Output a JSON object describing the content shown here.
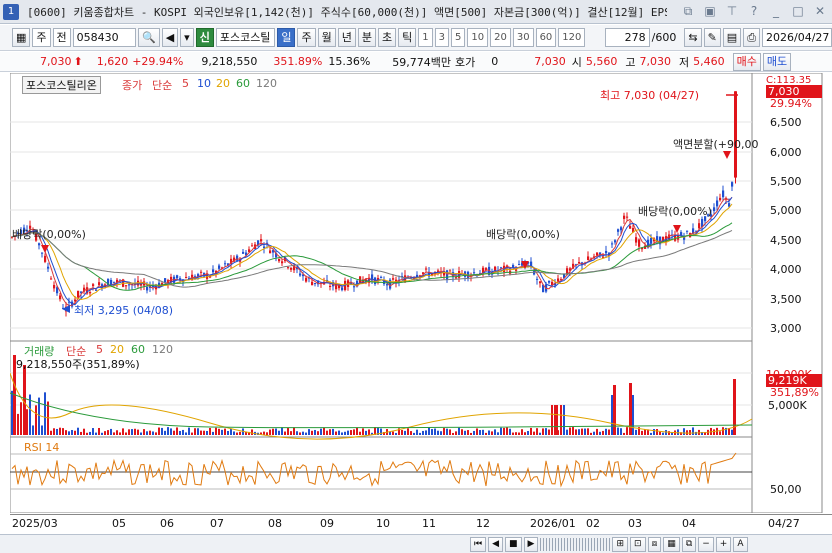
{
  "window": {
    "number": "1",
    "title": "[0600] 키움종합차트 - KOSPI 외국인보유[1,142(천)] 주식수[60,000(천)] 액면[500] 자본금[300(억)] 결산[12월] EPS"
  },
  "toolbar": {
    "market": "주",
    "market2": "전",
    "code": "058430",
    "badge": "신",
    "stock_name": "포스코스틸",
    "periods": [
      "일",
      "주",
      "월",
      "년",
      "분",
      "초",
      "틱"
    ],
    "active_period": "일",
    "intervals": [
      "1",
      "3",
      "5",
      "10",
      "20",
      "30",
      "60",
      "120"
    ],
    "count": "278",
    "count_total": "/600",
    "date": "2026/04/27"
  },
  "info": {
    "price": "7,030",
    "change": "1,620",
    "change_pct": "+29.94%",
    "volume": "9,218,550",
    "volume_pct": "351.89%",
    "turnover": "15.36%",
    "amount": "59,774백만",
    "hoga_label": "호가",
    "hoga_value": "0",
    "ask": "7,030",
    "open_label": "시",
    "open": "5,560",
    "high_label": "고",
    "high": "7,030",
    "low_label": "저",
    "low": "5,460",
    "sell_button": "매수",
    "buy_button": "매도"
  },
  "price_panel": {
    "stock_label": "포스코스틸리온",
    "legend": [
      "종가",
      "단순",
      "5",
      "10",
      "20",
      "60",
      "120"
    ],
    "axis_top_label": "C:113.35",
    "last_price": "7,030",
    "last_pct": "29.94%",
    "y_ticks": [
      "6,500",
      "6,000",
      "5,500",
      "5,000",
      "4,500",
      "4,000",
      "3,500",
      "3,000"
    ],
    "annotations": {
      "high": "최고 7,030 (04/27)",
      "low": "최저 3,295 (04/08)",
      "split": "액면분할(+90,00",
      "div1": "배당락(0,00%)",
      "div2": "배당락(0,00%)",
      "div3": "배당락(0,00%)"
    }
  },
  "volume_panel": {
    "legend": [
      "거래량",
      "단순",
      "5",
      "20",
      "60",
      "120"
    ],
    "value": "9,218,550주(351,89%)",
    "y_ticks": [
      "10,000K",
      "5,000K"
    ],
    "last_volume": "9,219K",
    "last_pct": "351,89%"
  },
  "rsi_panel": {
    "label": "RSI 14",
    "y_ticks": [
      "50,00"
    ]
  },
  "dates": [
    "2025/03",
    "05",
    "06",
    "07",
    "08",
    "09",
    "10",
    "11",
    "12",
    "2026/01",
    "02",
    "03",
    "04",
    "04/27"
  ],
  "colors": {
    "up": "#e0141a",
    "down": "#1f4fd1",
    "ma5": "#d93a3a",
    "ma10": "#1f4fd1",
    "ma20": "#e0a400",
    "ma60": "#2a9a3a",
    "ma120": "#7a7a7a",
    "rsi": "#e07a10"
  }
}
